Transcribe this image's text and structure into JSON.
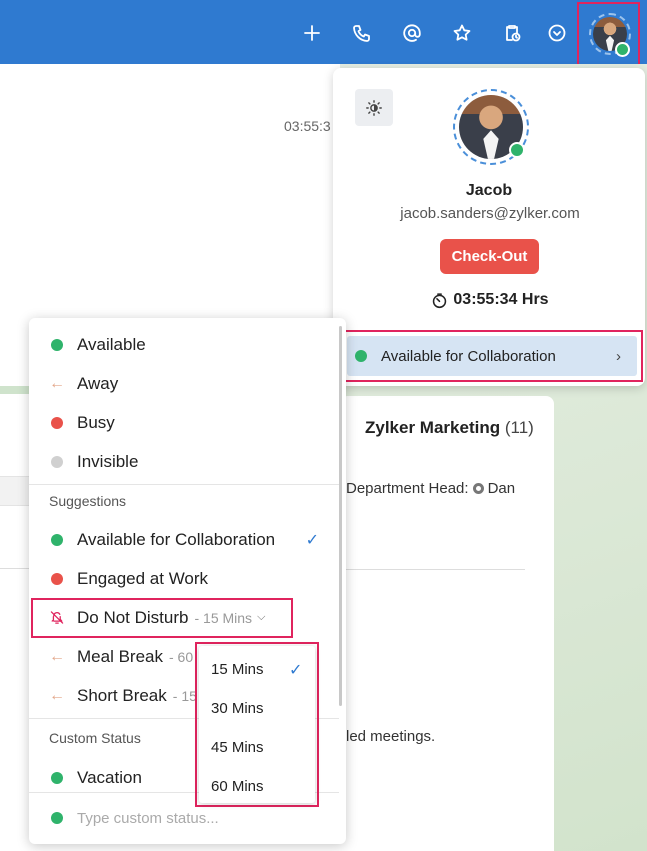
{
  "background": {
    "timestamp": "03:55:3",
    "group_title": "Zylker Marketing",
    "group_count": "(11)",
    "dept_head_label": "Department Head:",
    "dept_head_name": "Dan",
    "meetings_text": "led meetings."
  },
  "profile": {
    "name": "Jacob",
    "email": "jacob.sanders@zylker.com",
    "checkout_label": "Check-Out",
    "timer": "03:55:34 Hrs",
    "current_status": "Available for Collaboration"
  },
  "status_menu": {
    "items": [
      {
        "label": "Available",
        "indicator": "dot",
        "color": "#2fb36b"
      },
      {
        "label": "Away",
        "indicator": "arrow-left-icon",
        "color": "#e3a78a"
      },
      {
        "label": "Busy",
        "indicator": "dot",
        "color": "#e9524a"
      },
      {
        "label": "Invisible",
        "indicator": "dot",
        "color": "#d0d0d0"
      }
    ],
    "suggestions_label": "Suggestions",
    "suggestions": [
      {
        "label": "Available for Collaboration",
        "indicator": "dot",
        "color": "#2fb36b",
        "checked": true
      },
      {
        "label": "Engaged at Work",
        "indicator": "dot",
        "color": "#e9524a"
      },
      {
        "label": "Do Not Disturb",
        "duration": "- 15 Mins",
        "indicator": "bell-off-icon",
        "color": "#e0245e"
      },
      {
        "label": "Meal Break",
        "duration": "- 60",
        "indicator": "arrow-left-icon",
        "color": "#e3a78a"
      },
      {
        "label": "Short Break",
        "duration": "- 15",
        "indicator": "arrow-left-icon",
        "color": "#e3a78a"
      }
    ],
    "custom_label": "Custom Status",
    "custom": [
      {
        "label": "Vacation",
        "indicator": "dot",
        "color": "#2fb36b"
      }
    ],
    "custom_placeholder": "Type custom status..."
  },
  "duration_menu": {
    "options": [
      "15 Mins",
      "30 Mins",
      "45 Mins",
      "60 Mins"
    ],
    "selected": "15 Mins"
  },
  "colors": {
    "topbar": "#2f7ad0",
    "highlight": "#e0245e",
    "online": "#2fb36b",
    "checkout": "#e9524a"
  }
}
